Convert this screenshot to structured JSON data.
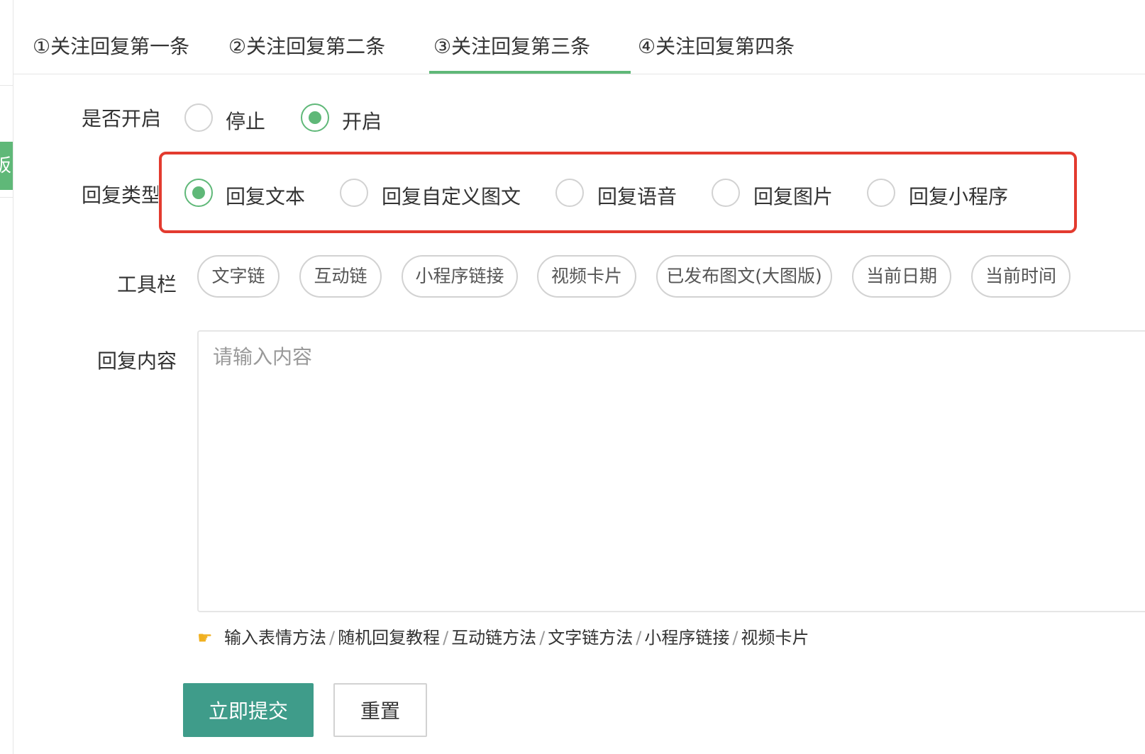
{
  "side_tag": "板",
  "tabs": [
    {
      "label": "①关注回复第一条"
    },
    {
      "label": "②关注回复第二条"
    },
    {
      "label": "③关注回复第三条",
      "active": true
    },
    {
      "label": "④关注回复第四条"
    }
  ],
  "enable": {
    "label": "是否开启",
    "options": [
      {
        "label": "停止",
        "selected": false
      },
      {
        "label": "开启",
        "selected": true
      }
    ]
  },
  "reply_type": {
    "label": "回复类型",
    "options": [
      {
        "label": "回复文本",
        "selected": true
      },
      {
        "label": "回复自定义图文",
        "selected": false
      },
      {
        "label": "回复语音",
        "selected": false
      },
      {
        "label": "回复图片",
        "selected": false
      },
      {
        "label": "回复小程序",
        "selected": false
      }
    ]
  },
  "toolbar": {
    "label": "工具栏",
    "buttons": [
      "文字链",
      "互动链",
      "小程序链接",
      "视频卡片",
      "已发布图文(大图版)",
      "当前日期",
      "当前时间"
    ]
  },
  "content": {
    "label": "回复内容",
    "placeholder": "请输入内容",
    "value": ""
  },
  "help_links": {
    "icon": "pointing-hand-icon",
    "items": [
      "输入表情方法",
      "随机回复教程",
      "互动链方法",
      "文字链方法",
      "小程序链接",
      "视频卡片"
    ],
    "separator": "/"
  },
  "actions": {
    "submit_label": "立即提交",
    "reset_label": "重置"
  },
  "colors": {
    "accent": "#5fb878",
    "submit": "#3f9c8a",
    "highlight": "#e33b2f"
  }
}
